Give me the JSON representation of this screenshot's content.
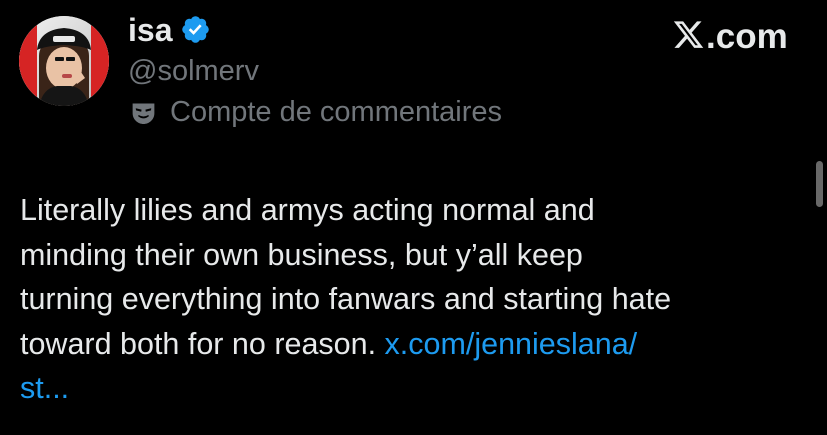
{
  "tweet": {
    "author": {
      "name": "isa",
      "handle": "@solmerv",
      "verified": true,
      "account_type_label": "Compte de commentaires",
      "account_type_icon": "parody-mask-icon",
      "verified_badge_icon": "verified-check-icon"
    },
    "source": {
      "logo_icon": "x-logo-icon",
      "suffix": ".com"
    },
    "text_lines": [
      "Literally lilies and armys acting normal and",
      "minding their own business, but y’all keep",
      "turning everything into fanwars and starting hate",
      "toward both for no reason. "
    ],
    "link": {
      "line_1": "x.com/jennieslana/",
      "line_2": "st..."
    }
  },
  "colors": {
    "background": "#000000",
    "primary_text": "#e7e9ea",
    "secondary_text": "#71767b",
    "link": "#1d9bf0",
    "verified": "#1d9bf0"
  }
}
